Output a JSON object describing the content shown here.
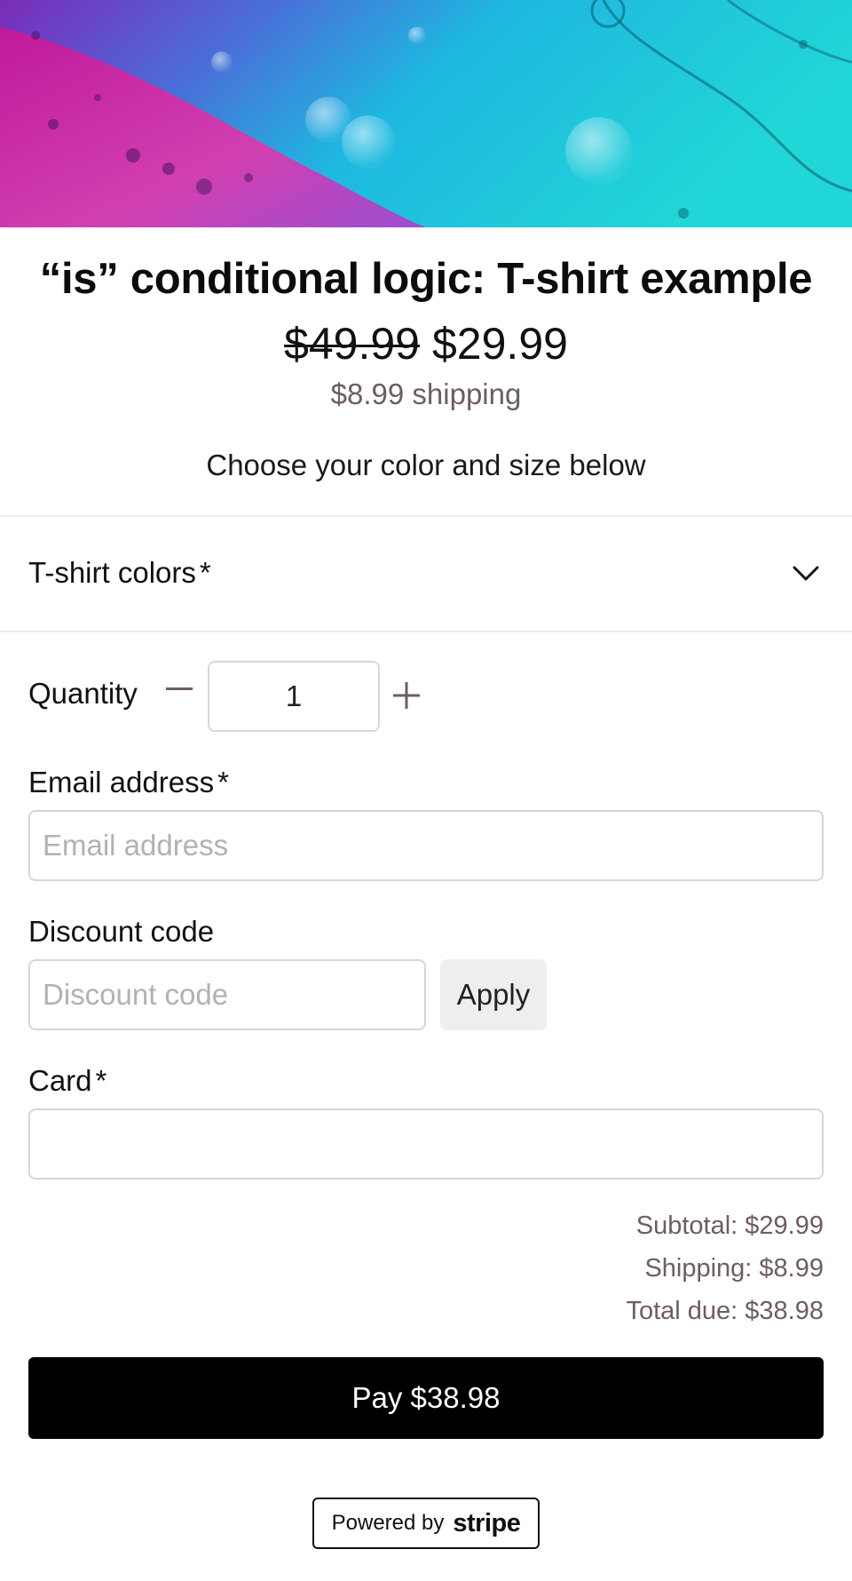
{
  "product": {
    "title": "“is” conditional logic: T-shirt example",
    "original_price": "$49.99",
    "sale_price": "$29.99",
    "shipping_note": "$8.99 shipping",
    "description": "Choose your color and size below"
  },
  "options": {
    "tshirt_colors_label": "T-shirt colors",
    "required_mark": "*",
    "expanded": false
  },
  "quantity": {
    "label": "Quantity",
    "value": "1"
  },
  "email": {
    "label": "Email address",
    "placeholder": "Email address",
    "value": ""
  },
  "discount": {
    "label": "Discount code",
    "placeholder": "Discount code",
    "apply_label": "Apply"
  },
  "card": {
    "label": "Card"
  },
  "summary": {
    "subtotal": "Subtotal: $29.99",
    "shipping": "Shipping: $8.99",
    "total": "Total due: $38.98"
  },
  "pay_button": {
    "label": "Pay $38.98"
  },
  "footer": {
    "powered_by": "Powered by",
    "brand": "stripe"
  },
  "icons": {
    "accordion": "chevron-down-icon",
    "decrement": "minus-icon",
    "increment": "plus-icon"
  },
  "colors": {
    "accent_text": "#6d5c66",
    "button_bg": "#000000",
    "border": "#d6d6d6"
  }
}
